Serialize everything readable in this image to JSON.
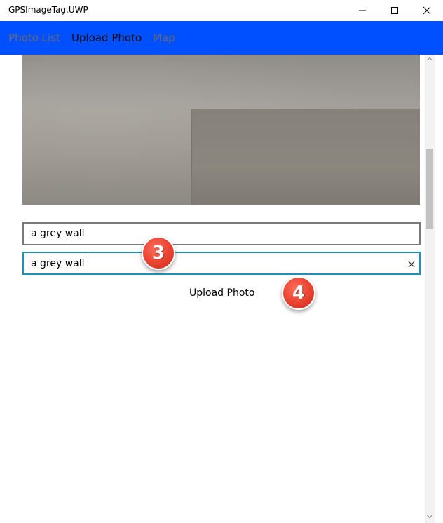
{
  "window": {
    "title": "GPSImageTag.UWP",
    "controls": [
      "minimize-icon",
      "maximize-icon",
      "close-icon"
    ]
  },
  "nav": {
    "items": [
      {
        "label": "Photo List",
        "active": false
      },
      {
        "label": "Upload Photo",
        "active": true
      },
      {
        "label": "Map",
        "active": false
      }
    ],
    "background": "#0050ff"
  },
  "form": {
    "field1_value": "a grey wall",
    "field2_value": "a grey wall",
    "upload_label": "Upload Photo",
    "focus_border": "#1f8fb8"
  },
  "annotations": {
    "badge3": "3",
    "badge4": "4",
    "color": "#e8412f"
  }
}
